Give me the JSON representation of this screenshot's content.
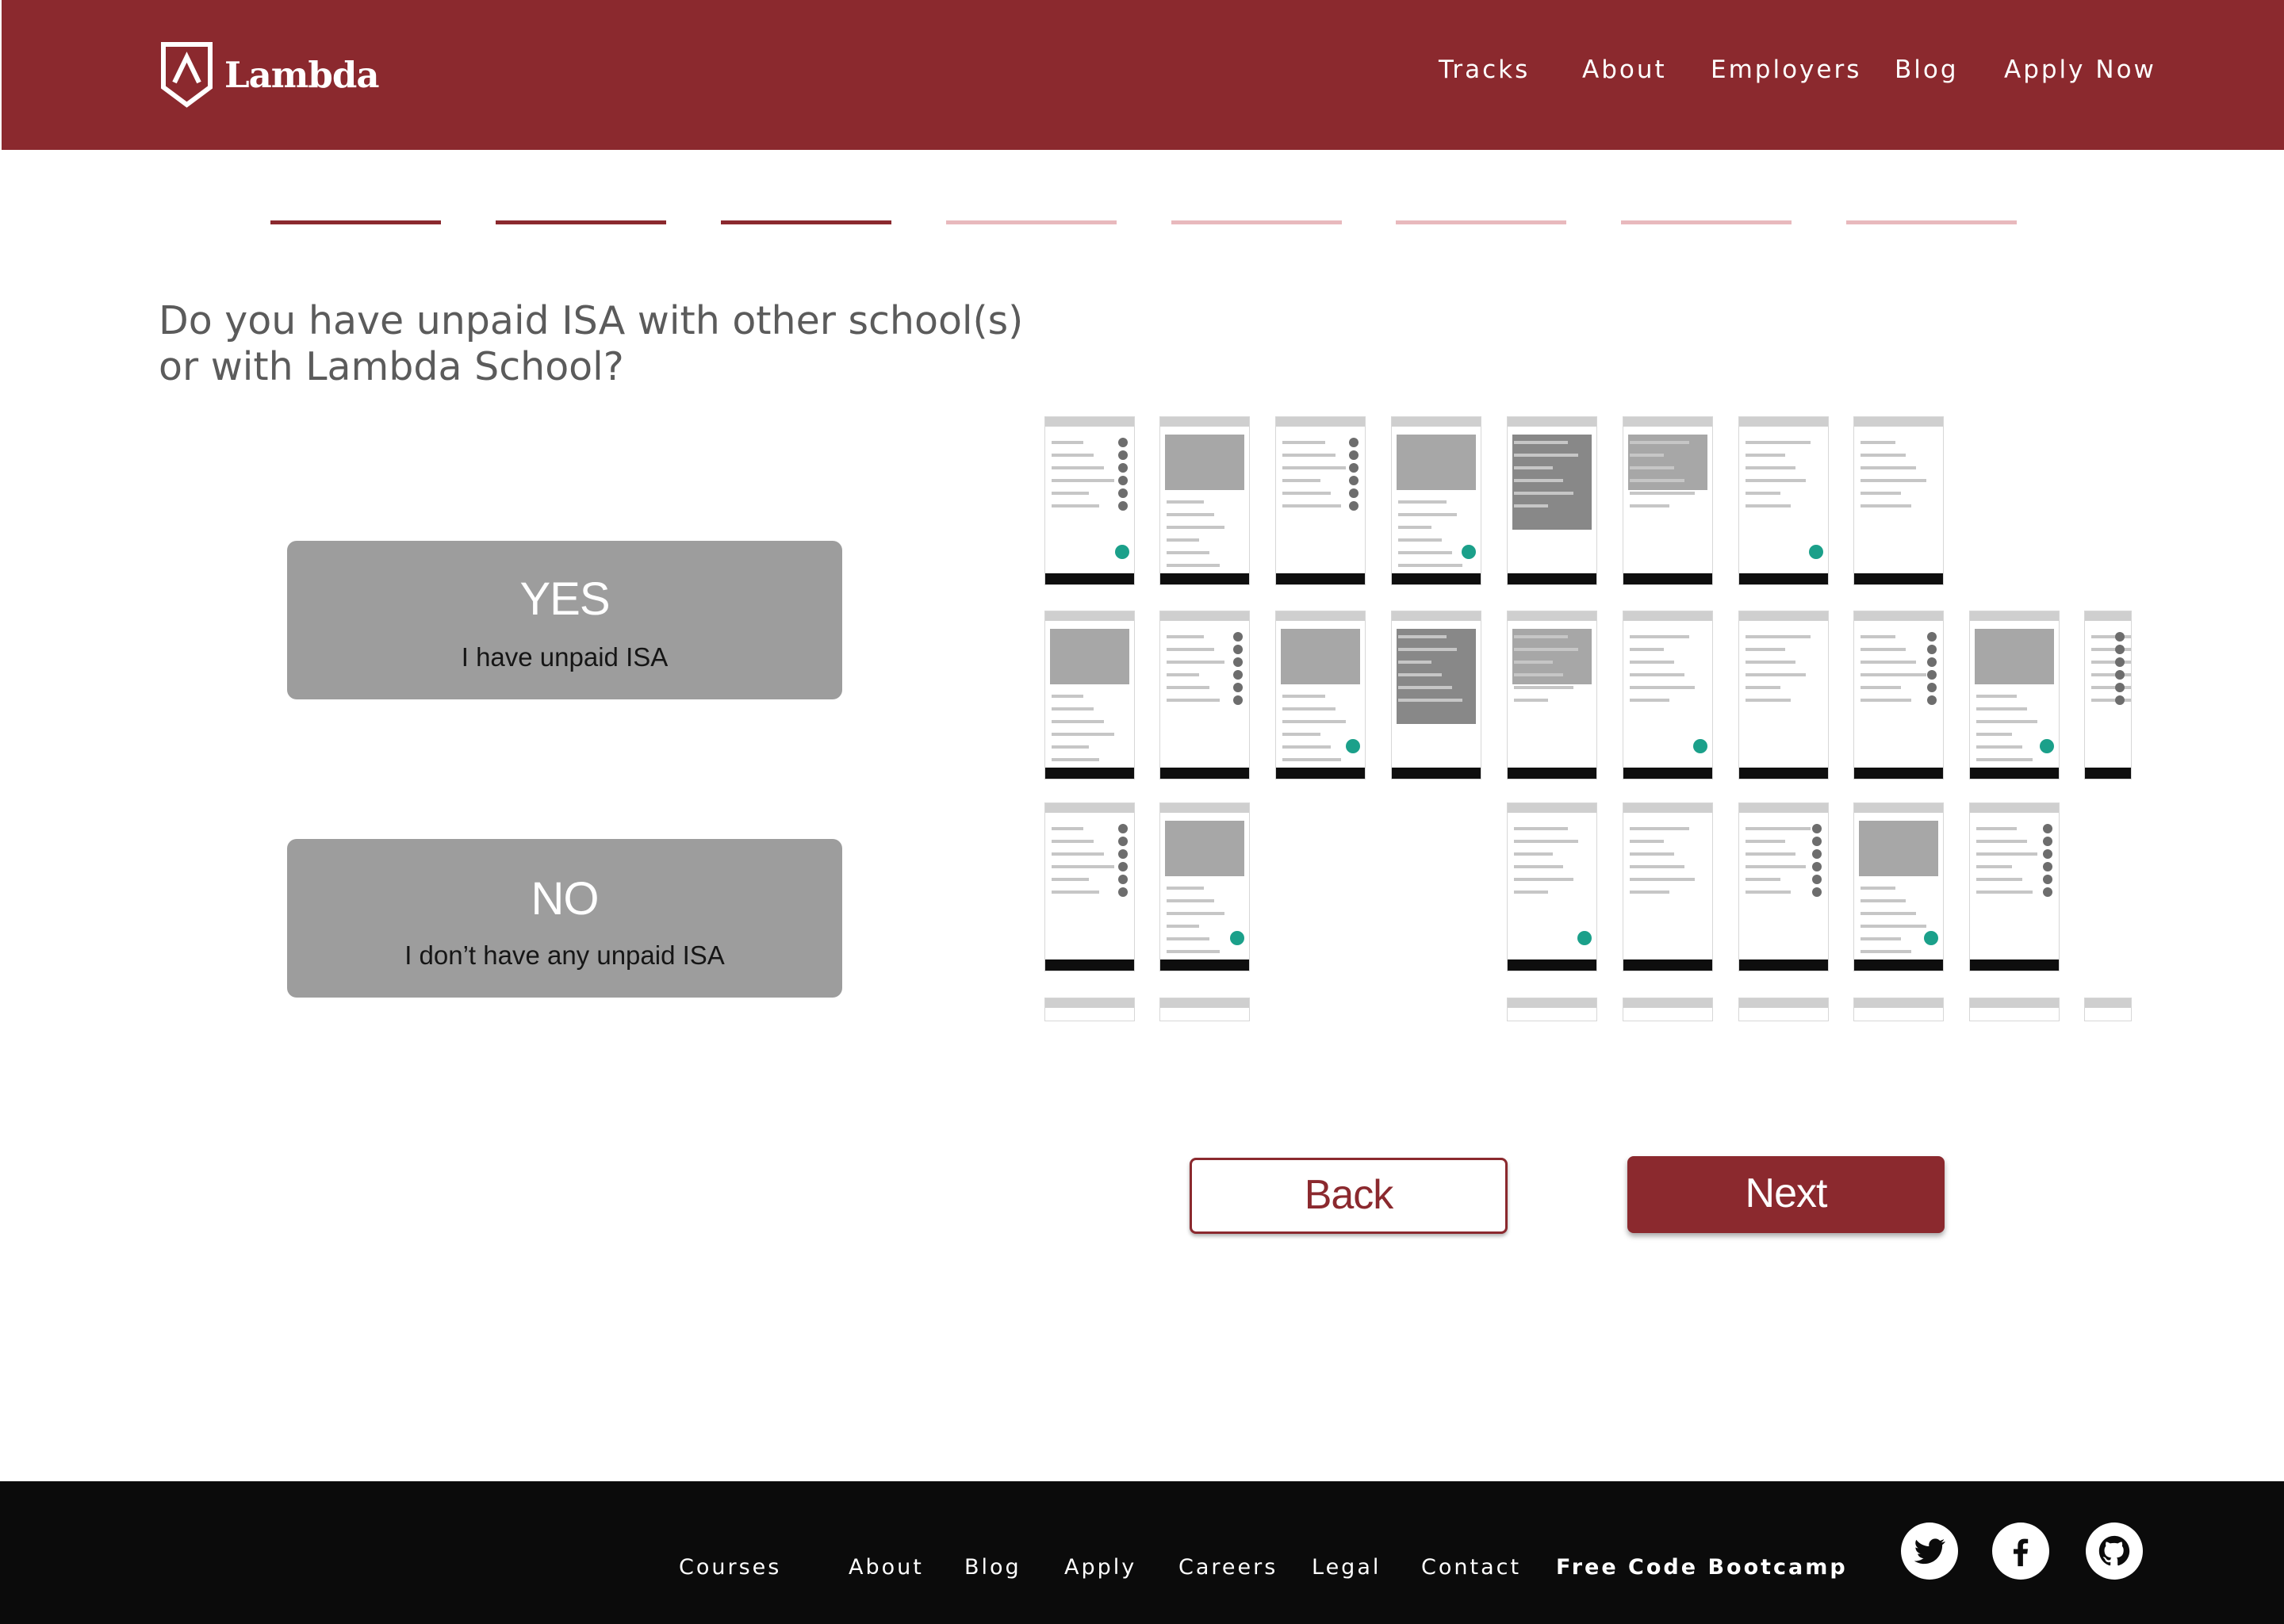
{
  "brand": {
    "name": "Lambda"
  },
  "header": {
    "nav": [
      "Tracks",
      "About",
      "Employers",
      "Blog",
      "Apply Now"
    ]
  },
  "progress": {
    "total_steps": 8,
    "completed_steps": 3,
    "active_color": "#8b292e",
    "inactive_color": "#e8b9bd"
  },
  "question": {
    "text": "Do you have unpaid ISA with other school(s) or with Lambda School?"
  },
  "choices": [
    {
      "title": "YES",
      "subtitle": "I have unpaid ISA"
    },
    {
      "title": "NO",
      "subtitle": "I don’t have any unpaid ISA"
    }
  ],
  "buttons": {
    "back": "Back",
    "next": "Next"
  },
  "footer": {
    "links": [
      "Courses",
      "About",
      "Blog",
      "Apply",
      "Careers",
      "Legal",
      "Contact"
    ],
    "highlight": "Free Code Bootcamp",
    "social": [
      "twitter-icon",
      "facebook-icon",
      "github-icon"
    ]
  },
  "colors": {
    "brand": "#8b292e",
    "choice_bg": "#9d9d9d",
    "footer_bg": "#0b0b0b",
    "accent": "#1ba08a"
  }
}
